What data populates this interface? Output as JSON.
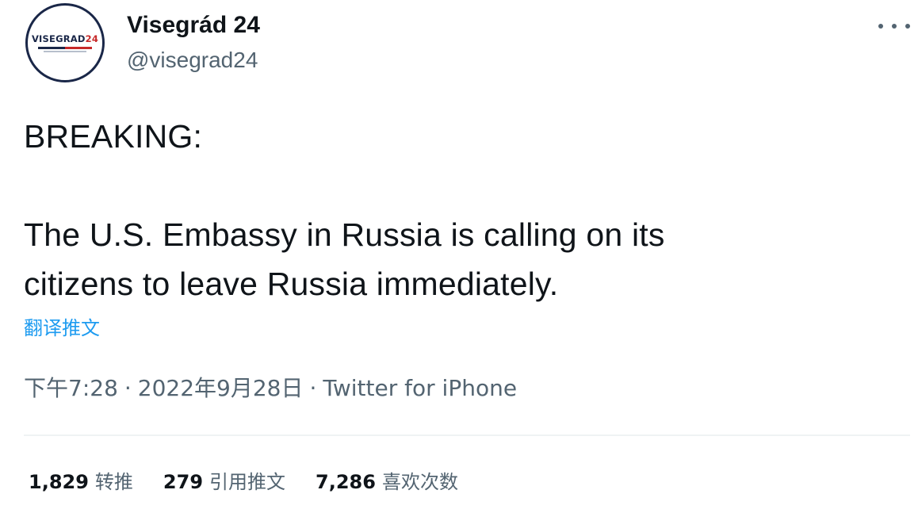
{
  "author": {
    "display_name": "Visegrád 24",
    "handle": "@visegrad24",
    "avatar_text_main": "VISEGRAD",
    "avatar_text_num": "24"
  },
  "tweet": {
    "line1": "BREAKING:",
    "line2": "The U.S. Embassy in Russia is calling on its",
    "line3": "citizens to leave Russia immediately.",
    "translate_label": "翻译推文"
  },
  "meta": {
    "time": "下午7:28",
    "separator": "·",
    "date": "2022年9月28日",
    "source": "Twitter for iPhone"
  },
  "stats": {
    "retweets_count": "1,829",
    "retweets_label": "转推",
    "quotes_count": "279",
    "quotes_label": "引用推文",
    "likes_count": "7,286",
    "likes_label": "喜欢次数"
  },
  "icons": {
    "more": "more-options-icon"
  },
  "colors": {
    "text_primary": "#0f1419",
    "text_secondary": "#536471",
    "link": "#1d9bf0",
    "avatar_navy": "#1a2748",
    "avatar_red": "#c62828"
  }
}
